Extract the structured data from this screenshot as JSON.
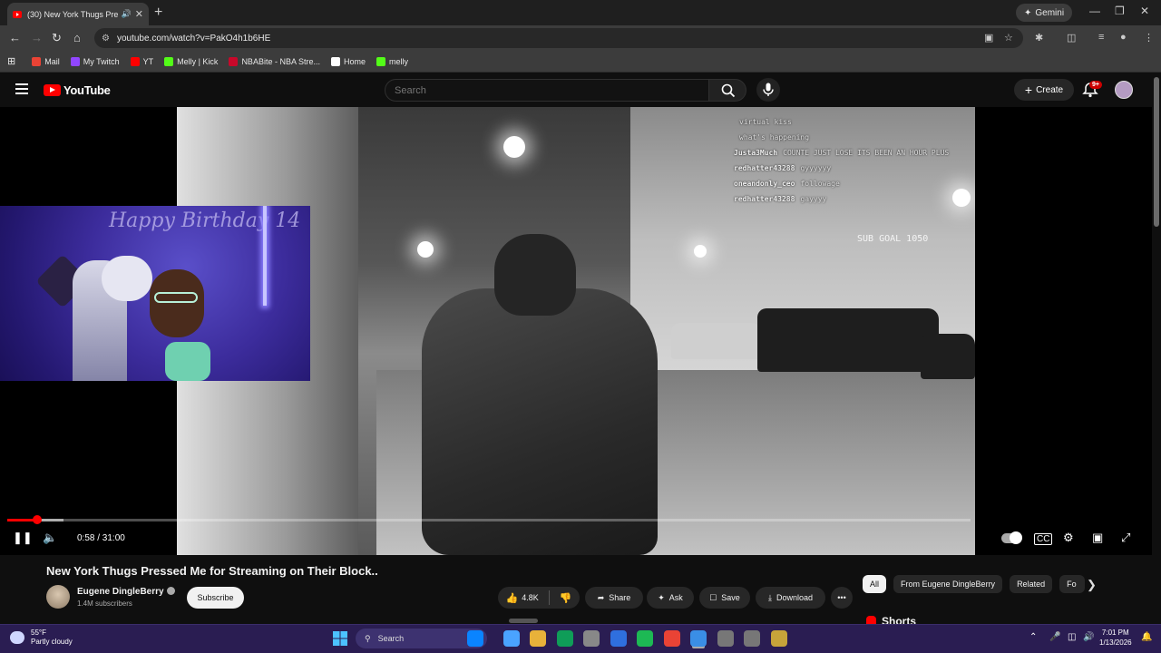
{
  "browser": {
    "tab_title": "(30) New York Thugs Press",
    "tab_close": "✕",
    "new_tab": "+",
    "gemini_label": "Gemini",
    "url": "youtube.com/watch?v=PakO4h1b6HE",
    "bookmarks": [
      {
        "label": "Mail",
        "color": "#ea4335"
      },
      {
        "label": "My Twitch",
        "color": "#9146ff"
      },
      {
        "label": "YT",
        "color": "#ff0000"
      },
      {
        "label": "Melly | Kick",
        "color": "#53fc18"
      },
      {
        "label": "NBABite - NBA Stre...",
        "color": "#c9082a"
      },
      {
        "label": "Home",
        "color": "#ffffff"
      },
      {
        "label": "melly",
        "color": "#53fc18"
      }
    ]
  },
  "youtube": {
    "logo_text": "YouTube",
    "search_placeholder": "Search",
    "create_label": "Create",
    "notification_count": "9+"
  },
  "player": {
    "current_time": "0:58",
    "duration": "31:00",
    "time_display": "0:58 / 31:00",
    "progress_fraction": 0.031,
    "buffer_fraction": 0.058,
    "chat_overlay": [
      {
        "user": "",
        "msg": "virtual kiss"
      },
      {
        "user": "",
        "msg": "what's happening"
      },
      {
        "user": "Justa3Much",
        "msg": "COUNTE JUST LOSE ITS BEEN AN HOUR PLUS"
      },
      {
        "user": "redhatter43288",
        "msg": "gyyyyyy"
      },
      {
        "user": "oneandonly_ceo",
        "msg": "followage"
      },
      {
        "user": "redhatter43288",
        "msg": "gayyyy"
      }
    ],
    "sub_overlay": "SUB GOAL 1050"
  },
  "video": {
    "title": "New York Thugs Pressed Me for Streaming on Their Block..",
    "channel": "Eugene DingleBerry",
    "subscribers": "1.4M subscribers",
    "subscribe_label": "Subscribe",
    "likes": "4.8K",
    "share_label": "Share",
    "ask_label": "Ask",
    "save_label": "Save",
    "download_label": "Download",
    "more_label": "•••"
  },
  "sidebar": {
    "chips": [
      "All",
      "From Eugene DingleBerry",
      "Related",
      "Fo"
    ],
    "shorts_label": "Shorts"
  },
  "taskbar": {
    "temperature": "55°F",
    "weather": "Partly cloudy",
    "search_label": "Search",
    "time": "7:01 PM",
    "date": "1/13/2026",
    "icon_colors": [
      "#0a84ff",
      "#4aa3ff",
      "#e8b23a",
      "#0f9d58",
      "#888888",
      "#2f6fde",
      "#1db954",
      "#ea4335",
      "#3a8ee6",
      "#777777",
      "#777777",
      "#c7a43a"
    ]
  }
}
